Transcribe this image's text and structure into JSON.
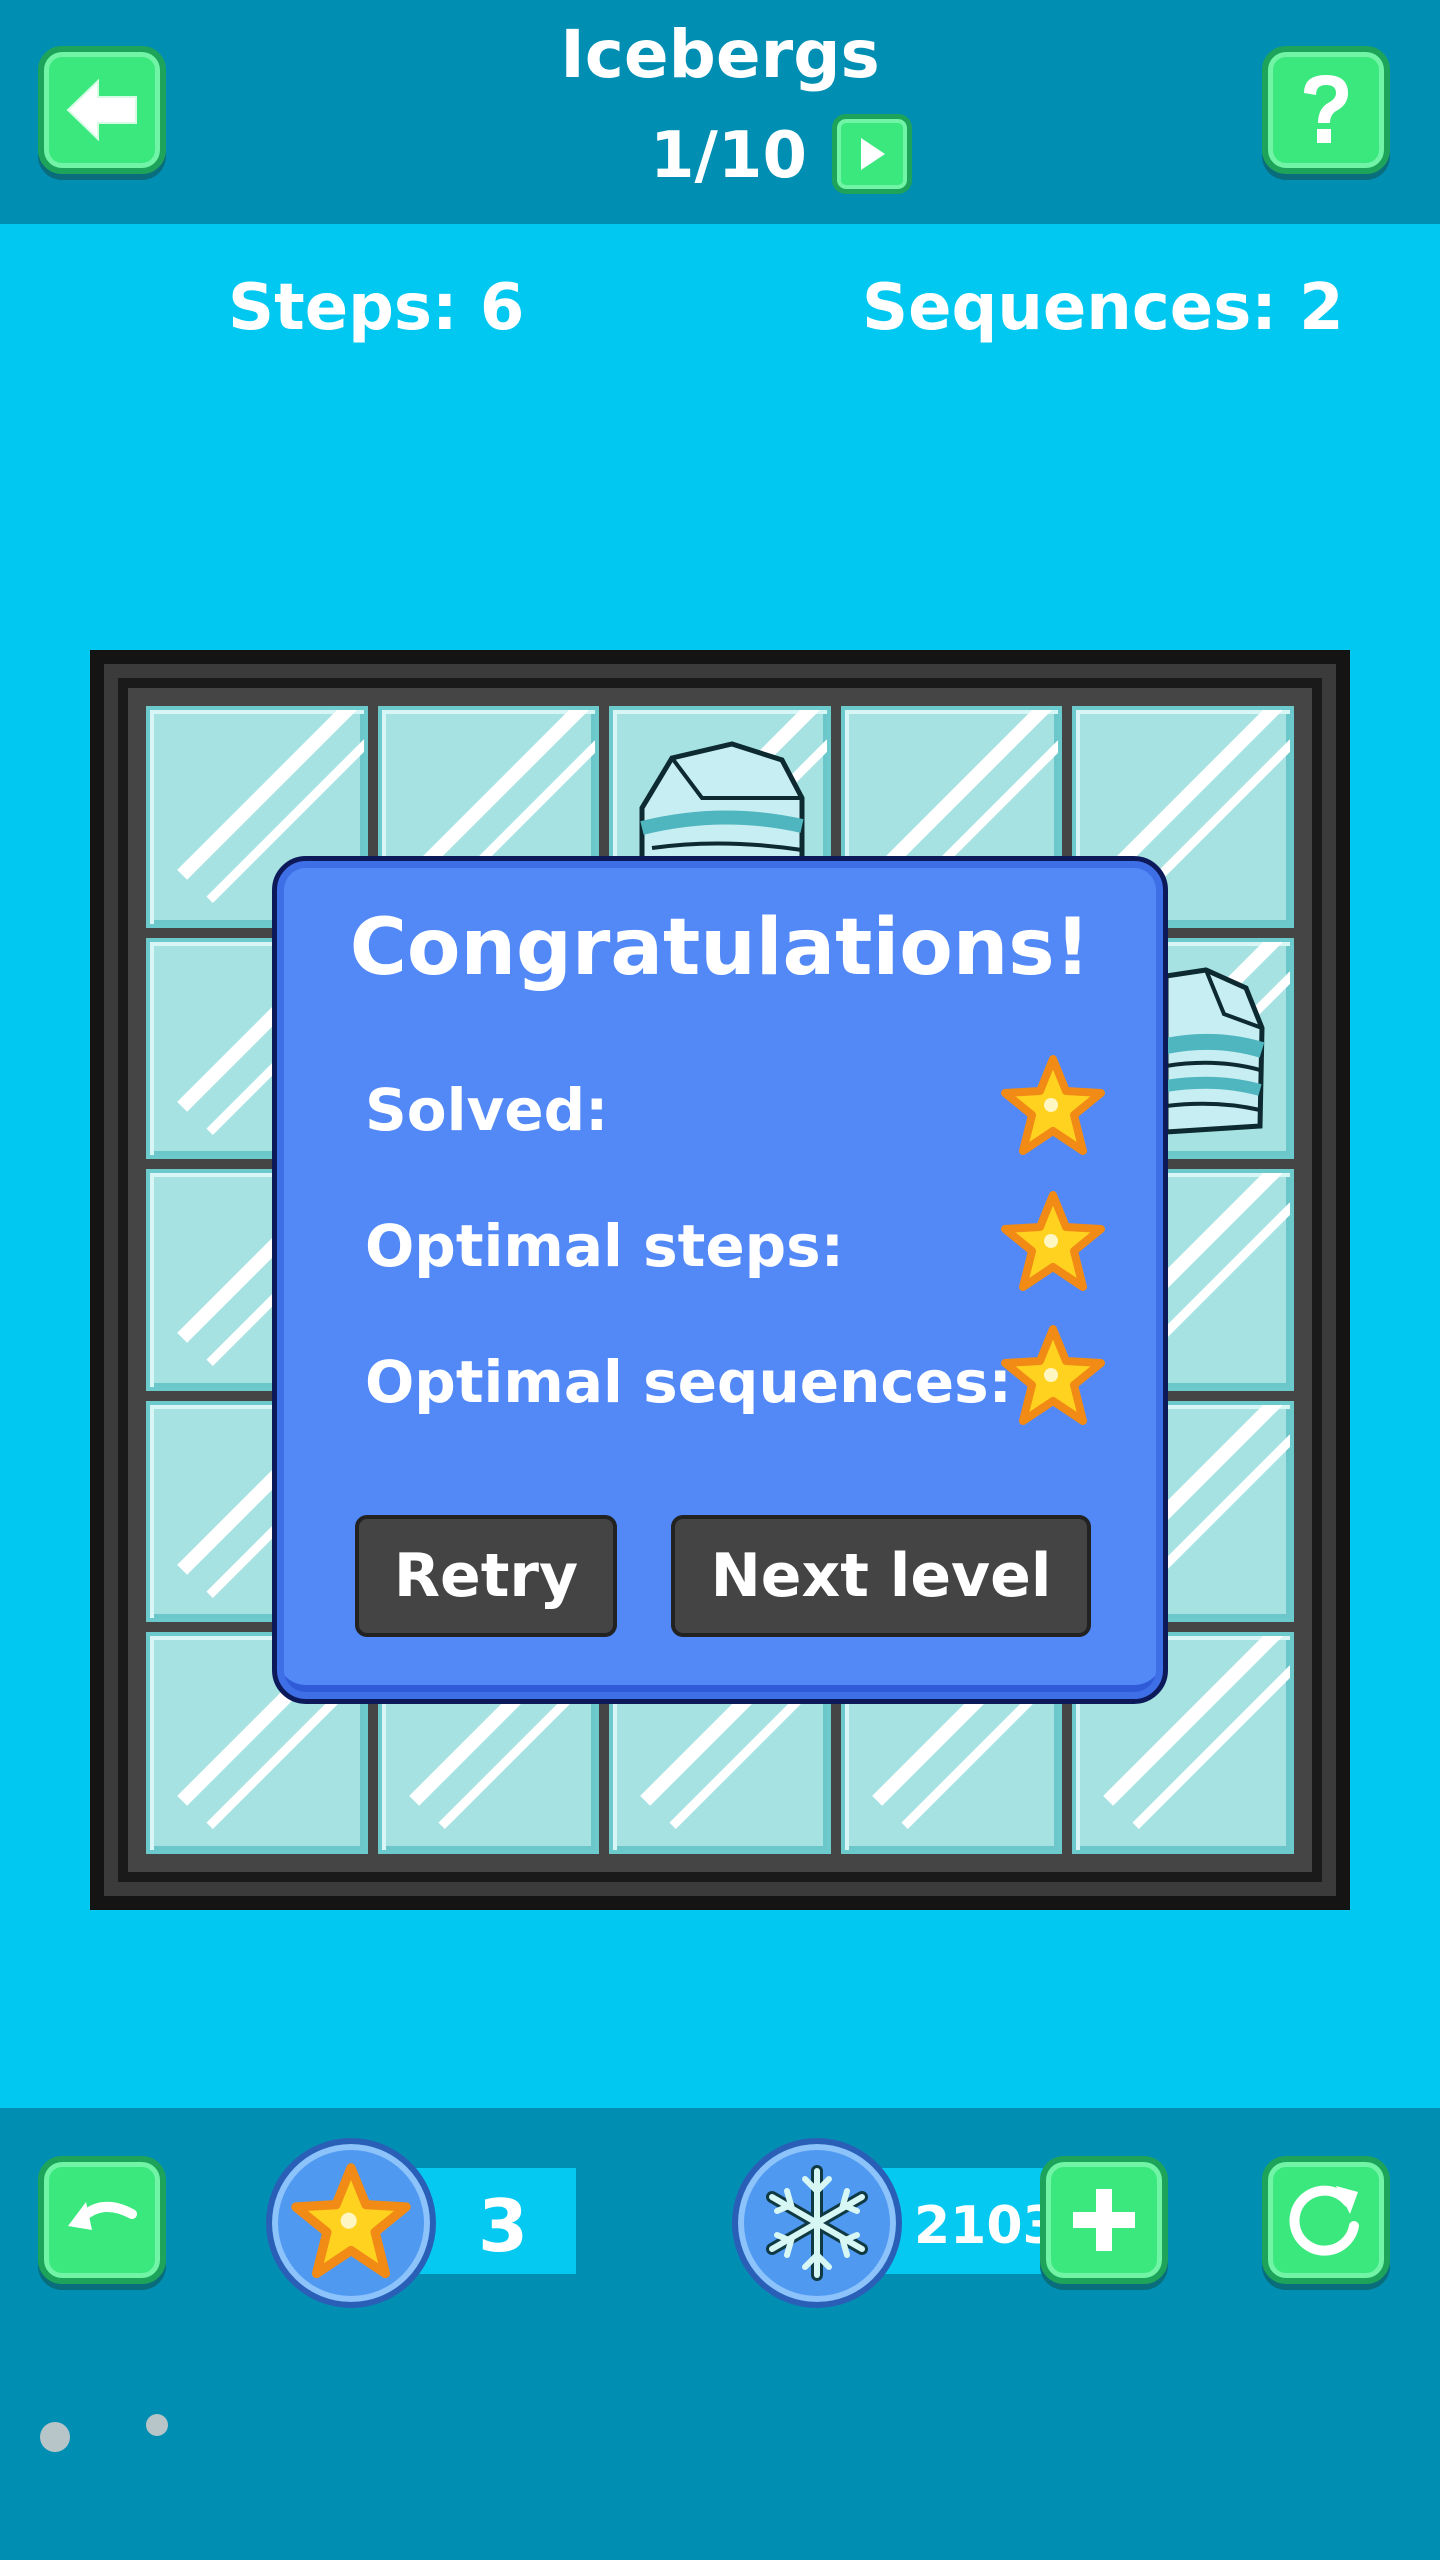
{
  "header": {
    "title": "Icebergs",
    "level": "1/10"
  },
  "stats": {
    "steps": "Steps: 6",
    "sequences": "Sequences: 2"
  },
  "dialog": {
    "title": "Congratulations!",
    "rows": [
      {
        "label": "Solved:",
        "star": "gold-star"
      },
      {
        "label": "Optimal steps:",
        "star": "gold-star"
      },
      {
        "label": "Optimal sequences:",
        "star": "gold-star"
      }
    ],
    "retry_label": "Retry",
    "next_label": "Next level"
  },
  "footer": {
    "stars_count": "3",
    "snowflakes_count": "2103"
  },
  "colors": {
    "background": "#01c8f0",
    "bar": "#008fb3",
    "button_green": "#3be87e",
    "dialog_blue": "#5289f7",
    "tile_ice": "#a7e2e3"
  },
  "icons": [
    "back-arrow-icon",
    "help-icon",
    "play-icon",
    "undo-icon",
    "star-icon",
    "snowflake-icon",
    "plus-icon",
    "restart-icon",
    "iceberg-icon"
  ]
}
